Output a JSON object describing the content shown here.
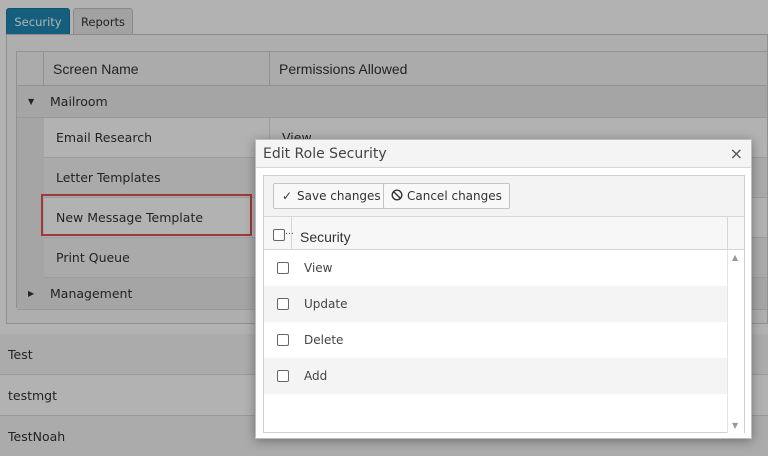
{
  "tabs": [
    {
      "label": "Security"
    },
    {
      "label": "Reports"
    }
  ],
  "grid": {
    "headers": {
      "screen_name": "Screen Name",
      "permissions": "Permissions Allowed"
    },
    "groups": {
      "mailroom": "Mailroom",
      "management": "Management"
    },
    "rows": [
      {
        "name": "Email Research",
        "permissions": "View"
      },
      {
        "name": "Letter Templates",
        "permissions": ""
      },
      {
        "name": "New Message Template",
        "permissions": ""
      },
      {
        "name": "Print Queue",
        "permissions": ""
      }
    ]
  },
  "roles": [
    "Test",
    "testmgt",
    "TestNoah"
  ],
  "dialog": {
    "title": "Edit Role Security",
    "close_glyph": "×",
    "save_label": "Save changes",
    "cancel_label": "Cancel changes",
    "column_header": "Security",
    "options": [
      {
        "label": "View",
        "checked": false
      },
      {
        "label": "Update",
        "checked": false
      },
      {
        "label": "Delete",
        "checked": false
      },
      {
        "label": "Add",
        "checked": false
      }
    ]
  },
  "colors": {
    "accent": "#1e88b4",
    "highlight": "#e05353"
  }
}
